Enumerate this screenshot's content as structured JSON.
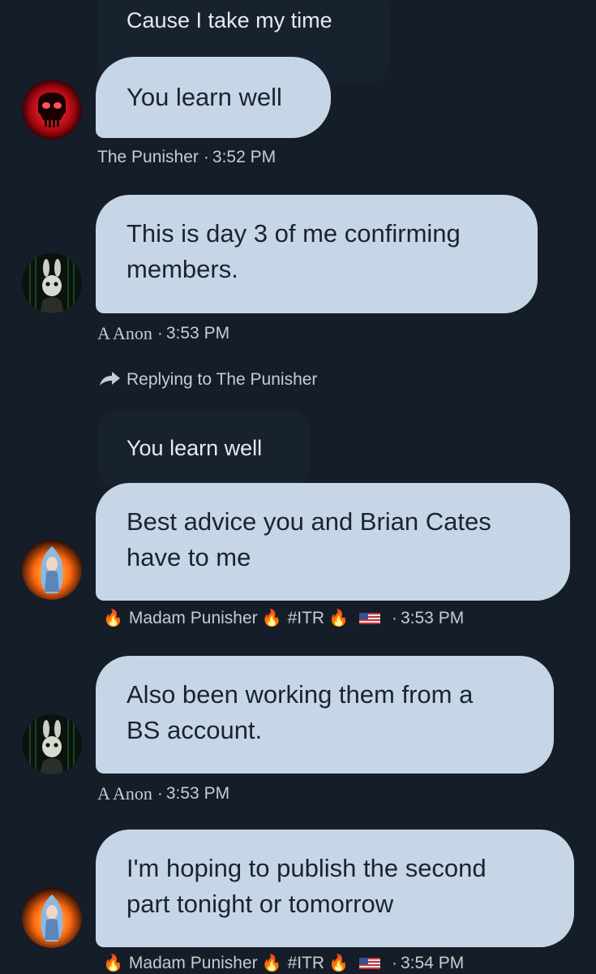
{
  "messages": [
    {
      "quote": "Cause I take my time",
      "text": "You learn well",
      "author": "The Punisher",
      "time": "3:52 PM"
    },
    {
      "text_lines": [
        "This is day 3 of me confirming",
        "members."
      ],
      "author": "A Anon",
      "time": "3:53 PM"
    },
    {
      "replying_label": "Replying to The Punisher",
      "quote": "You learn well",
      "text_lines": [
        "Best advice you and Brian Cates",
        "have to me"
      ],
      "author_prefix": "🔥",
      "author": "Madam Punisher",
      "author_mid": "🔥",
      "author_tag": "#ITR",
      "author_suffix": "🔥",
      "time": "3:53 PM"
    },
    {
      "text_lines": [
        "Also been working them from a",
        "BS account."
      ],
      "author": "A Anon",
      "time": "3:53 PM"
    },
    {
      "text_lines": [
        "I'm hoping to publish the second",
        "part tonight or tomorrow"
      ],
      "author_prefix": "🔥",
      "author": "Madam Punisher",
      "author_mid": "🔥",
      "author_tag": "#ITR",
      "author_suffix": "🔥",
      "time": "3:54 PM"
    }
  ],
  "separator": "·",
  "icons": {
    "punisher_avatar": "skull-icon",
    "anon_avatar": "rabbit-mask-icon",
    "madam_avatar": "fire-woman-icon",
    "reply": "reply-arrow-icon",
    "flag": "us-flag-icon"
  },
  "colors": {
    "background": "#141d28",
    "bubble": "#c7d6e6",
    "quote": "#18222f",
    "meta_text": "#c6ccd3"
  }
}
